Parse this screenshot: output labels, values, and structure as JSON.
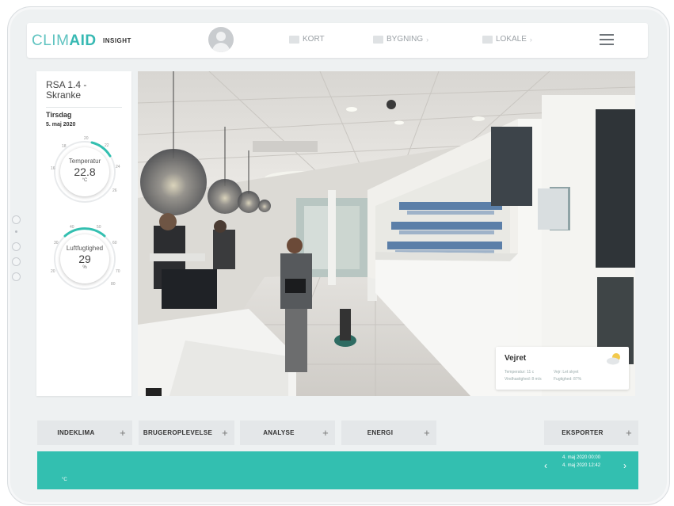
{
  "logo": {
    "part1": "CLIM",
    "part2": "AID",
    "sub": "INSIGHT"
  },
  "nav": [
    {
      "label": "KORT",
      "chevron": ""
    },
    {
      "label": "BYGNING",
      "chevron": "›"
    },
    {
      "label": "LOKALE",
      "chevron": "›"
    }
  ],
  "panel": {
    "location": "RSA 1.4 - Skranke",
    "day": "Tirsdag",
    "date": "5. maj 2020"
  },
  "temperature": {
    "label": "Temperatur",
    "value": "22.8",
    "unit": "°C",
    "level": 0.62,
    "ticks": [
      "20",
      "22",
      "24",
      "26",
      "28",
      "18",
      "16"
    ]
  },
  "humidity": {
    "label": "Luftfugtighed",
    "value": "29",
    "unit": "%",
    "level": 0.29,
    "ticks": [
      "40",
      "50",
      "30",
      "60",
      "20",
      "70",
      "80"
    ]
  },
  "weather": {
    "title": "Vejret",
    "temperature_label": "Temperatur: 11 c",
    "wind_label": "Vindhastighed: 8 m/s",
    "sky_label": "Vejr: Let skyet",
    "humidity_label": "Fugtighed: 87%"
  },
  "tabs": [
    {
      "label": "INDEKLIMA",
      "plus": "+"
    },
    {
      "label": "BRUGEROPLEVELSE",
      "plus": "+"
    },
    {
      "label": "ANALYSE",
      "plus": "+"
    },
    {
      "label": "ENERGI",
      "plus": "+"
    },
    {
      "label": "EKSPORTER",
      "plus": "+"
    }
  ],
  "footer": {
    "unit": "°C",
    "date_from": "4. maj 2020 00:00",
    "date_to": "4. maj 2020 12:42",
    "prev": "‹",
    "next": "›"
  },
  "colors": {
    "accent": "#33bfb0",
    "brand": "#37b9b3"
  }
}
